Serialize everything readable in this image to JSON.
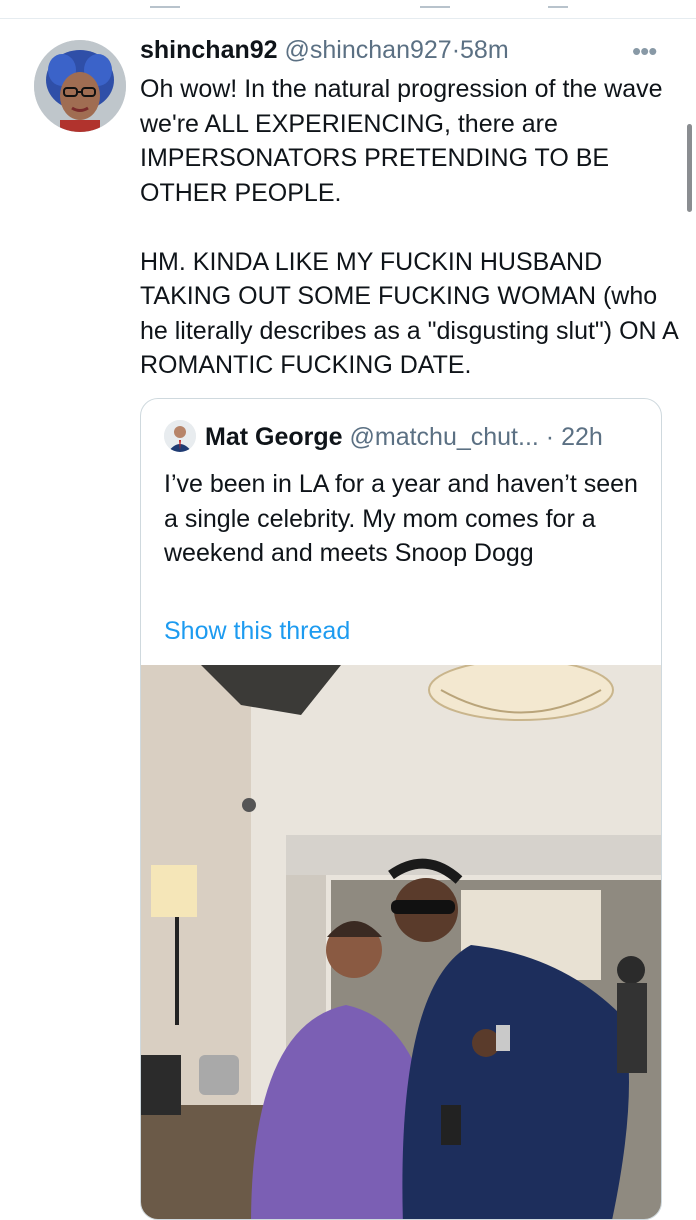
{
  "tweet": {
    "display_name": "shinchan92",
    "handle": "@shinchan927",
    "separator": "·",
    "time": "58m",
    "more_icon": "more-icon",
    "paragraph1": "Oh wow! In the natural progression of the wave we're ALL EXPERIENCING, there are IMPERSONATORS PRETENDING TO BE OTHER PEOPLE.",
    "paragraph2": "HM. KINDA LIKE MY FUCKIN HUSBAND TAKING OUT SOME FUCKING WOMAN (who he literally describes as a \"disgusting slut\") ON A ROMANTIC FUCKING DATE."
  },
  "quote": {
    "display_name": "Mat George",
    "handle": "@matchu_chut...",
    "separator": "·",
    "time": "22h",
    "text": "I’ve been in LA for a year and haven’t seen a single celebrity. My mom comes for a weekend and meets Snoop Dogg",
    "link": "Show this thread",
    "link_color": "#1d9bf0"
  }
}
